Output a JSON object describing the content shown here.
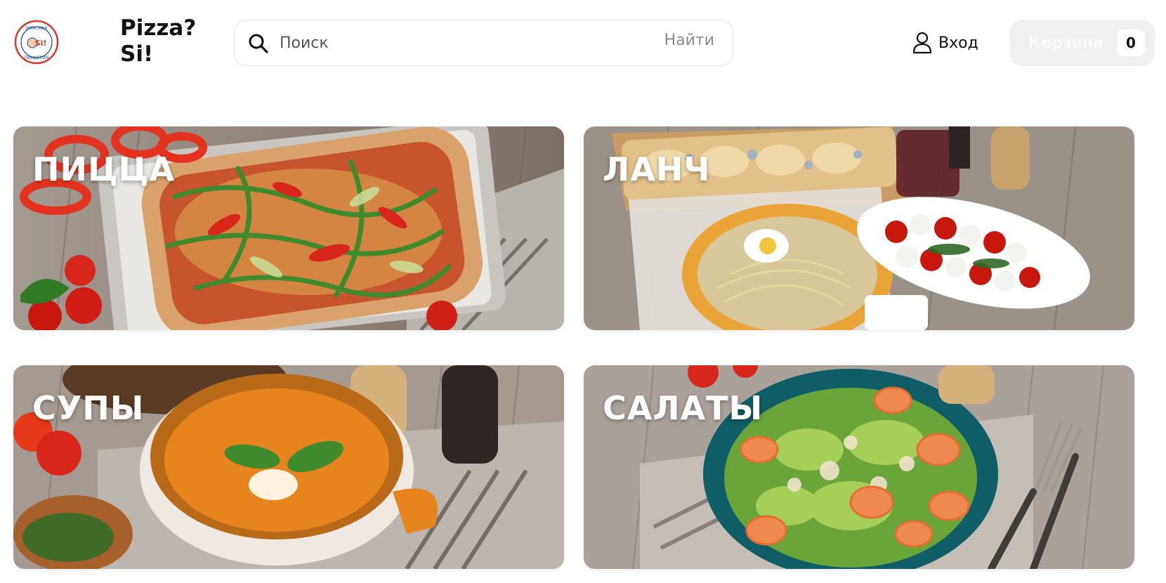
{
  "header": {
    "logo_icon": "pizzeria-logo-icon",
    "logo_text_top": "РИМСКАЯ",
    "logo_text_bottom": "ПИЦЦЕРИЯ",
    "logo_text_center": "Si!",
    "brand_line1": "Pizza?",
    "brand_line2": "Si!",
    "search": {
      "icon": "search-icon",
      "placeholder": "Поиск",
      "button_label": "Найти"
    },
    "login": {
      "icon": "user-icon",
      "label": "Вход"
    },
    "cart": {
      "label": "Корзина",
      "count": "0"
    }
  },
  "categories": [
    {
      "title": "ПИЦЦА"
    },
    {
      "title": "ЛАНЧ"
    },
    {
      "title": "СУПЫ"
    },
    {
      "title": "САЛАТЫ"
    }
  ],
  "colors": {
    "wood": "#8b7d70",
    "tomato": "#d8261a",
    "orange_soup": "#e8841e",
    "salad_bowl": "#0f5d66",
    "cart_bg": "#f0f0ee"
  }
}
